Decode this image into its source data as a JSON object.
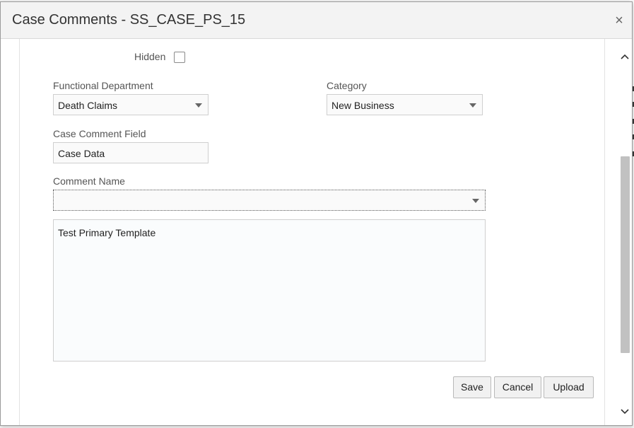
{
  "modal": {
    "title": "Case Comments - SS_CASE_PS_15",
    "close_glyph": "×"
  },
  "form": {
    "hidden_label": "Hidden",
    "hidden_checked": false,
    "functional_department": {
      "label": "Functional Department",
      "value": "Death Claims"
    },
    "category": {
      "label": "Category",
      "value": "New Business"
    },
    "case_comment_field": {
      "label": "Case Comment Field",
      "value": "Case Data"
    },
    "comment_name": {
      "label": "Comment Name",
      "value": ""
    },
    "comment_text": "Test Primary Template"
  },
  "buttons": {
    "save": "Save",
    "cancel": "Cancel",
    "upload": "Upload"
  },
  "scrollbar": {
    "up_glyph": "⌃",
    "down_glyph": "⌄"
  },
  "icons": {
    "dropdown": "chevron-down-icon",
    "close": "close-icon"
  }
}
